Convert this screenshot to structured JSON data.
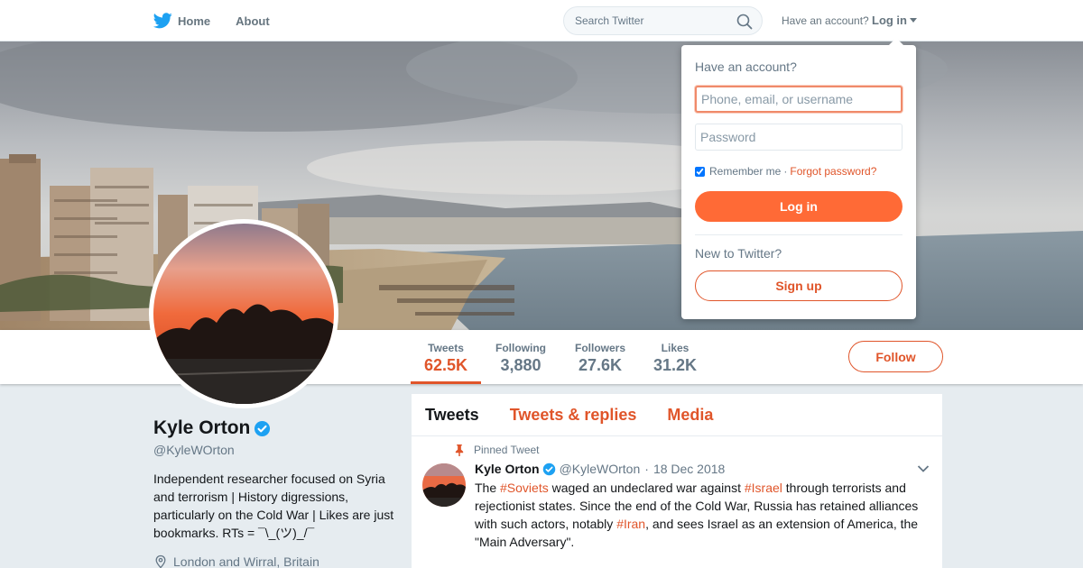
{
  "nav": {
    "home_label": "Home",
    "about_label": "About",
    "search_placeholder": "Search Twitter",
    "have_account": "Have an account?",
    "login_label": "Log in"
  },
  "profile": {
    "name": "Kyle Orton",
    "handle": "@KyleWOrton",
    "bio": "Independent researcher focused on Syria and terrorism | History digressions, particularly on the Cold War | Likes are just bookmarks. RTs = ¯\\_(ツ)_/¯",
    "location": "London and Wirral, Britain",
    "verified": true
  },
  "stats": [
    {
      "label": "Tweets",
      "value": "62.5K",
      "active": true
    },
    {
      "label": "Following",
      "value": "3,880",
      "active": false
    },
    {
      "label": "Followers",
      "value": "27.6K",
      "active": false
    },
    {
      "label": "Likes",
      "value": "31.2K",
      "active": false
    }
  ],
  "follow_label": "Follow",
  "timeline": {
    "tabs": [
      {
        "label": "Tweets",
        "active": true
      },
      {
        "label": "Tweets & replies",
        "active": false
      },
      {
        "label": "Media",
        "active": false
      }
    ],
    "pinned_label": "Pinned Tweet",
    "tweet": {
      "name": "Kyle Orton",
      "handle": "@KyleWOrton",
      "separator": "·",
      "date": "18 Dec 2018",
      "text_parts": [
        "The ",
        "#Soviets",
        " waged an undeclared war against ",
        "#Israel",
        " through terrorists and rejectionist states. Since the end of the Cold War, Russia has retained alliances with such actors, notably ",
        "#Iran",
        ", and sees Israel as an extension of America, the \"Main Adversary\"."
      ]
    }
  },
  "login_dropdown": {
    "title": "Have an account?",
    "username_placeholder": "Phone, email, or username",
    "password_placeholder": "Password",
    "remember_label": "Remember me",
    "separator": "·",
    "forgot_label": "Forgot password?",
    "login_button": "Log in",
    "new_label": "New to Twitter?",
    "signup_button": "Sign up",
    "remember_checked": true
  },
  "colors": {
    "accent": "#e0552a",
    "login_button": "#ff6a36",
    "verified": "#1da1f2",
    "twitter_blue": "#1da1f2"
  }
}
